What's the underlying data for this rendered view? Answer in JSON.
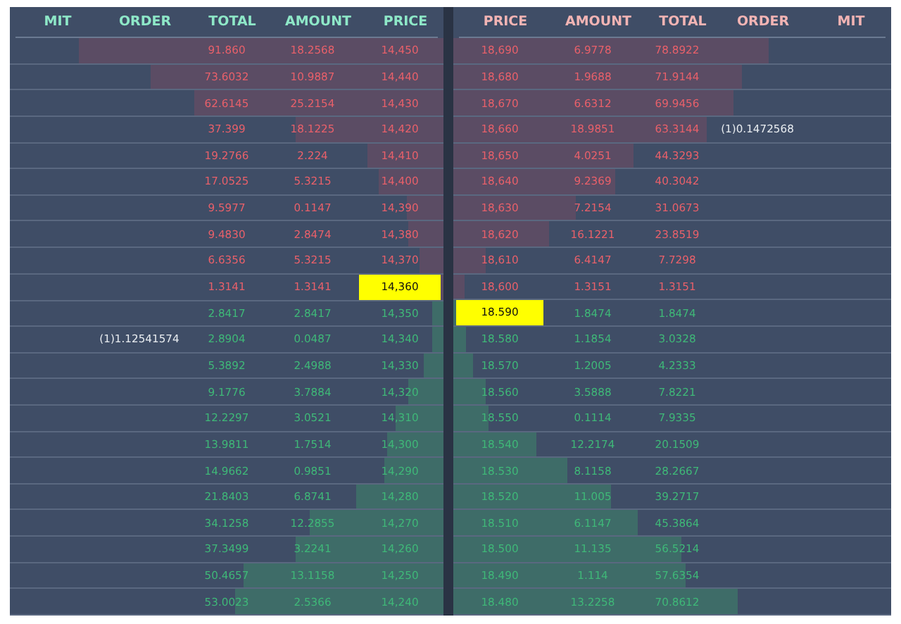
{
  "panels": [
    {
      "columns": [
        {
          "label": "MIT",
          "kind": "mit"
        },
        {
          "label": "ORDER",
          "kind": "order"
        },
        {
          "label": "TOTAL",
          "kind": "total"
        },
        {
          "label": "AMOUNT",
          "kind": "amount"
        },
        {
          "label": "PRICE",
          "kind": "price"
        }
      ],
      "rows": [
        {
          "kind": "ask",
          "total": "91.860",
          "amount": "18.2568",
          "price": "14,450",
          "level": 0.84,
          "highlighted": false
        },
        {
          "kind": "ask",
          "total": "73.6032",
          "amount": "10.9887",
          "price": "14,440",
          "level": 0.675,
          "highlighted": false
        },
        {
          "kind": "ask",
          "total": "62.6145",
          "amount": "25.2154",
          "price": "14,430",
          "level": 0.575,
          "highlighted": false
        },
        {
          "kind": "ask",
          "total": "37.399",
          "amount": "18.1225",
          "price": "14,420",
          "level": 0.34,
          "highlighted": false
        },
        {
          "kind": "ask",
          "total": "19.2766",
          "amount": "2.224",
          "price": "14,410",
          "level": 0.175,
          "highlighted": false
        },
        {
          "kind": "ask",
          "total": "17.0525",
          "amount": "5.3215",
          "price": "14,400",
          "level": 0.15,
          "highlighted": false
        },
        {
          "kind": "ask",
          "total": "9.5977",
          "amount": "0.1147",
          "price": "14,390",
          "level": 0.085,
          "highlighted": false
        },
        {
          "kind": "ask",
          "total": "9.4830",
          "amount": "2.8474",
          "price": "14,380",
          "level": 0.08,
          "highlighted": false
        },
        {
          "kind": "ask",
          "total": "6.6356",
          "amount": "5.3215",
          "price": "14,370",
          "level": 0.055,
          "highlighted": false
        },
        {
          "kind": "ask",
          "total": "1.3141",
          "amount": "1.3141",
          "price": "14,360",
          "level": 0.025,
          "highlighted": true
        },
        {
          "kind": "bid",
          "total": "2.8417",
          "amount": "2.8417",
          "price": "14,350",
          "level": 0.025,
          "highlighted": false
        },
        {
          "kind": "bid",
          "order": "(1)1.12541574",
          "total": "2.8904",
          "amount": "0.0487",
          "price": "14,340",
          "level": 0.025,
          "highlighted": false
        },
        {
          "kind": "bid",
          "total": "5.3892",
          "amount": "2.4988",
          "price": "14,330",
          "level": 0.045,
          "highlighted": false
        },
        {
          "kind": "bid",
          "total": "9.1776",
          "amount": "3.7884",
          "price": "14,320",
          "level": 0.08,
          "highlighted": false
        },
        {
          "kind": "bid",
          "total": "12.2297",
          "amount": "3.0521",
          "price": "14,310",
          "level": 0.11,
          "highlighted": false
        },
        {
          "kind": "bid",
          "total": "13.9811",
          "amount": "1.7514",
          "price": "14,300",
          "level": 0.13,
          "highlighted": false
        },
        {
          "kind": "bid",
          "total": "14.9662",
          "amount": "0.9851",
          "price": "14,290",
          "level": 0.135,
          "highlighted": false
        },
        {
          "kind": "bid",
          "total": "21.8403",
          "amount": "6.8741",
          "price": "14,280",
          "level": 0.2,
          "highlighted": false
        },
        {
          "kind": "bid",
          "total": "34.1258",
          "amount": "12.2855",
          "price": "14,270",
          "level": 0.31,
          "highlighted": false
        },
        {
          "kind": "bid",
          "total": "37.3499",
          "amount": "3.2241",
          "price": "14,260",
          "level": 0.34,
          "highlighted": false
        },
        {
          "kind": "bid",
          "total": "50.4657",
          "amount": "13.1158",
          "price": "14,250",
          "level": 0.46,
          "highlighted": false
        },
        {
          "kind": "bid",
          "total": "53.0023",
          "amount": "2.5366",
          "price": "14,240",
          "level": 0.48,
          "highlighted": false
        }
      ]
    },
    {
      "columns": [
        {
          "label": "PRICE",
          "kind": "price"
        },
        {
          "label": "AMOUNT",
          "kind": "amount"
        },
        {
          "label": "TOTAL",
          "kind": "total"
        },
        {
          "label": "ORDER",
          "kind": "order"
        },
        {
          "label": "MIT",
          "kind": "mit"
        }
      ],
      "rows": [
        {
          "kind": "ask",
          "price": "18,690",
          "amount": "6.9778",
          "total": "78.8922",
          "level": 0.72,
          "highlighted": false
        },
        {
          "kind": "ask",
          "price": "18,680",
          "amount": "1.9688",
          "total": "71.9144",
          "level": 0.66,
          "highlighted": false
        },
        {
          "kind": "ask",
          "price": "18,670",
          "amount": "6.6312",
          "total": "69.9456",
          "level": 0.64,
          "highlighted": false
        },
        {
          "kind": "ask",
          "price": "18,660",
          "amount": "18.9851",
          "total": "63.3144",
          "order": "(1)0.1472568",
          "level": 0.58,
          "highlighted": false
        },
        {
          "kind": "ask",
          "price": "18,650",
          "amount": "4.0251",
          "total": "44.3293",
          "level": 0.41,
          "highlighted": false
        },
        {
          "kind": "ask",
          "price": "18,640",
          "amount": "9.2369",
          "total": "40.3042",
          "level": 0.37,
          "highlighted": false
        },
        {
          "kind": "ask",
          "price": "18,630",
          "amount": "7.2154",
          "total": "31.0673",
          "level": 0.28,
          "highlighted": false
        },
        {
          "kind": "ask",
          "price": "18,620",
          "amount": "16.1221",
          "total": "23.8519",
          "level": 0.22,
          "highlighted": false
        },
        {
          "kind": "ask",
          "price": "18,610",
          "amount": "6.4147",
          "total": "7.7298",
          "level": 0.074,
          "highlighted": false
        },
        {
          "kind": "ask",
          "price": "18,600",
          "amount": "1.3151",
          "total": "1.3151",
          "level": 0.026,
          "highlighted": false
        },
        {
          "kind": "bid",
          "price": "18.590",
          "amount": "1.8474",
          "total": "1.8474",
          "level": 0.026,
          "highlighted": true
        },
        {
          "kind": "bid",
          "price": "18.580",
          "amount": "1.1854",
          "total": "3.0328",
          "level": 0.03,
          "highlighted": false
        },
        {
          "kind": "bid",
          "price": "18.570",
          "amount": "1.2005",
          "total": "4.2333",
          "level": 0.045,
          "highlighted": false
        },
        {
          "kind": "bid",
          "price": "18.560",
          "amount": "3.5888",
          "total": "7.8221",
          "level": 0.074,
          "highlighted": false
        },
        {
          "kind": "bid",
          "price": "18.550",
          "amount": "0.1114",
          "total": "7.9335",
          "level": 0.08,
          "highlighted": false
        },
        {
          "kind": "bid",
          "price": "18.540",
          "amount": "12.2174",
          "total": "20.1509",
          "level": 0.19,
          "highlighted": false
        },
        {
          "kind": "bid",
          "price": "18.530",
          "amount": "8.1158",
          "total": "28.2667",
          "level": 0.26,
          "highlighted": false
        },
        {
          "kind": "bid",
          "price": "18.520",
          "amount": "11.005",
          "total": "39.2717",
          "level": 0.36,
          "highlighted": false
        },
        {
          "kind": "bid",
          "price": "18.510",
          "amount": "6.1147",
          "total": "45.3864",
          "level": 0.42,
          "highlighted": false
        },
        {
          "kind": "bid",
          "price": "18.500",
          "amount": "11.135",
          "total": "56.5214",
          "level": 0.52,
          "highlighted": false
        },
        {
          "kind": "bid",
          "price": "18.490",
          "amount": "1.114",
          "total": "57.6354",
          "level": 0.53,
          "highlighted": false
        },
        {
          "kind": "bid",
          "price": "18.480",
          "amount": "13.2258",
          "total": "70.8612",
          "level": 0.65,
          "highlighted": false
        }
      ]
    }
  ]
}
